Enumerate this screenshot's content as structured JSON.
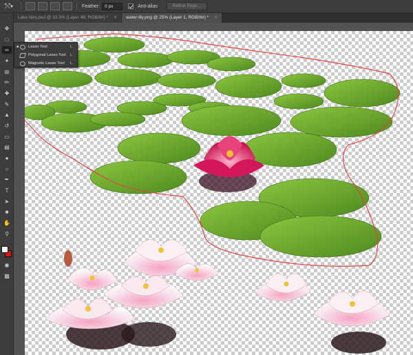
{
  "options_bar": {
    "feather_label": "Feather:",
    "feather_value": "0 px",
    "anti_alias_label": "Anti-alias",
    "refine_edge_label": "Refine Edge...",
    "tool_icon": "lasso-icon"
  },
  "tabs": [
    {
      "label": "Lake fairy.psd @ 33.3% (Layer 48, RGB/8#) *",
      "active": false
    },
    {
      "label": "water-lily.png @ 25% (Layer 1, RGB/8#) *",
      "active": true
    }
  ],
  "toolbar": {
    "tools": [
      "move-icon",
      "marquee-icon",
      "lasso-icon",
      "quick-select-icon",
      "crop-icon",
      "eyedropper-icon",
      "healing-icon",
      "brush-icon",
      "stamp-icon",
      "history-brush-icon",
      "eraser-icon",
      "gradient-icon",
      "blur-icon",
      "dodge-icon",
      "pen-icon",
      "type-icon",
      "path-select-icon",
      "shape-icon",
      "hand-icon",
      "zoom-icon"
    ],
    "foreground_color": "#ffffff",
    "background_color": "#e01010"
  },
  "flyout": {
    "items": [
      {
        "label": "Lasso Tool",
        "shortcut": "L",
        "selected": true
      },
      {
        "label": "Polygonal Lasso Tool",
        "shortcut": "L",
        "selected": false
      },
      {
        "label": "Magnetic Lasso Tool",
        "shortcut": "L",
        "selected": false
      }
    ]
  },
  "colors": {
    "selection_outline": "#e84040",
    "lily_pad": "#6aa82e",
    "pink_lily": "#d81b5a",
    "white_lily": "#f4dce6"
  }
}
